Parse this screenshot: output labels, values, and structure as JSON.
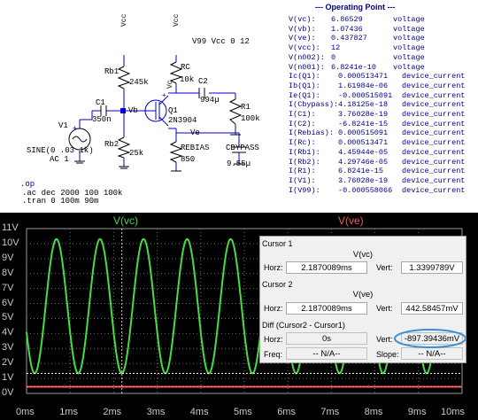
{
  "schematic": {
    "directive": "V99 Vcc 0 12",
    "components": {
      "rb1": {
        "name": "Rb1",
        "value": "245k"
      },
      "rb2": {
        "name": "Rb2",
        "value": "25k"
      },
      "rc": {
        "name": "RC",
        "value": "10k"
      },
      "rebias": {
        "name": "REBIAS",
        "value": "850"
      },
      "r1": {
        "name": "R1",
        "value": "100k"
      },
      "c1": {
        "name": "C1",
        "value": "350n"
      },
      "c2": {
        "name": "C2",
        "value": "994µ"
      },
      "cbypass": {
        "name": "CBYPASS",
        "value": "9.55µ"
      },
      "q1": {
        "name": "Q1",
        "value": "2N3904"
      },
      "v1": {
        "name": "V1",
        "value": "SINE(0 .03 1k)",
        "ac": "AC 1"
      }
    },
    "nets": {
      "vb": "Vb",
      "ve": "Ve",
      "vcc": "Vcc",
      "vc": "Vc"
    },
    "commands": [
      ".ac dec 2000 100 100k",
      ".tran 0 100m 90m",
      ".op"
    ]
  },
  "operating_point": {
    "title": "--- Operating Point ---",
    "rows": [
      {
        "name": "V(vc):",
        "value": "6.86529",
        "unit": "voltage"
      },
      {
        "name": "V(vb):",
        "value": "1.07436",
        "unit": "voltage"
      },
      {
        "name": "V(ve):",
        "value": "0.437827",
        "unit": "voltage"
      },
      {
        "name": "V(vcc):",
        "value": "12",
        "unit": "voltage"
      },
      {
        "name": "V(n002):",
        "value": "0",
        "unit": "voltage"
      },
      {
        "name": "V(n001):",
        "value": "6.8241e-10",
        "unit": "voltage"
      },
      {
        "name": "Ic(Q1):",
        "value": "0.000513471",
        "unit": "device_current"
      },
      {
        "name": "Ib(Q1):",
        "value": "1.61984e-06",
        "unit": "device_current"
      },
      {
        "name": "Ie(Q1):",
        "value": "-0.000515091",
        "unit": "device_current"
      },
      {
        "name": "I(Cbypass):",
        "value": "4.18125e-18",
        "unit": "device_current"
      },
      {
        "name": "I(C1):",
        "value": "3.76028e-19",
        "unit": "device_current"
      },
      {
        "name": "I(C2):",
        "value": "-6.8241e-15",
        "unit": "device_current"
      },
      {
        "name": "I(Rebias):",
        "value": "0.000515091",
        "unit": "device_current"
      },
      {
        "name": "I(Rc):",
        "value": "0.000513471",
        "unit": "device_current"
      },
      {
        "name": "I(Rb1):",
        "value": "4.45944e-05",
        "unit": "device_current"
      },
      {
        "name": "I(Rb2):",
        "value": "4.29746e-05",
        "unit": "device_current"
      },
      {
        "name": "I(R1):",
        "value": "6.8241e-15",
        "unit": "device_current"
      },
      {
        "name": "I(V1):",
        "value": "3.76028e-19",
        "unit": "device_current"
      },
      {
        "name": "I(V99):",
        "value": "-0.000558066",
        "unit": "device_current"
      }
    ]
  },
  "waveform": {
    "traces": [
      {
        "label": "V(vc)",
        "color": "#44dd44"
      },
      {
        "label": "V(ve)",
        "color": "#ff5555"
      }
    ],
    "y_ticks": [
      "11V",
      "10V",
      "9V",
      "8V",
      "7V",
      "6V",
      "5V",
      "4V",
      "3V",
      "2V",
      "1V",
      "0V"
    ],
    "x_ticks": [
      "0ms",
      "1ms",
      "2ms",
      "3ms",
      "4ms",
      "5ms",
      "6ms",
      "7ms",
      "8ms",
      "9ms",
      "10ms"
    ]
  },
  "cursor_panel": {
    "cursor1": {
      "title": "Cursor 1",
      "trace": "V(vc)",
      "horz_label": "Horz:",
      "horz": "2.1870089ms",
      "vert_label": "Vert:",
      "vert": "1.3399789V"
    },
    "cursor2": {
      "title": "Cursor 2",
      "trace": "V(ve)",
      "horz_label": "Horz:",
      "horz": "2.1870089ms",
      "vert_label": "Vert:",
      "vert": "442.58457mV"
    },
    "diff": {
      "title": "Diff (Cursor2 - Cursor1)",
      "horz_label": "Horz:",
      "horz": "0s",
      "vert_label": "Vert:",
      "vert": "-897.39436mV",
      "freq_label": "Freq:",
      "freq": "-- N/A--",
      "slope_label": "Slope:",
      "slope": "-- N/A--"
    }
  },
  "chart_data": {
    "type": "line",
    "title": "",
    "xlabel": "",
    "ylabel": "",
    "xlim": [
      0,
      10
    ],
    "ylim": [
      0,
      11
    ],
    "x_unit": "ms",
    "y_unit": "V",
    "grid": true,
    "series": [
      {
        "name": "V(vc)",
        "shape": "sine",
        "frequency_khz": 1,
        "min": 1.34,
        "max": 10.3,
        "trough_ms": 0.187
      },
      {
        "name": "V(ve)",
        "shape": "flat",
        "value": 0.44
      }
    ],
    "cursors": [
      {
        "x": 2.1870089,
        "trace": "V(vc)",
        "y": 1.3399789
      },
      {
        "x": 2.1870089,
        "trace": "V(ve)",
        "y": 0.44258457
      }
    ]
  }
}
